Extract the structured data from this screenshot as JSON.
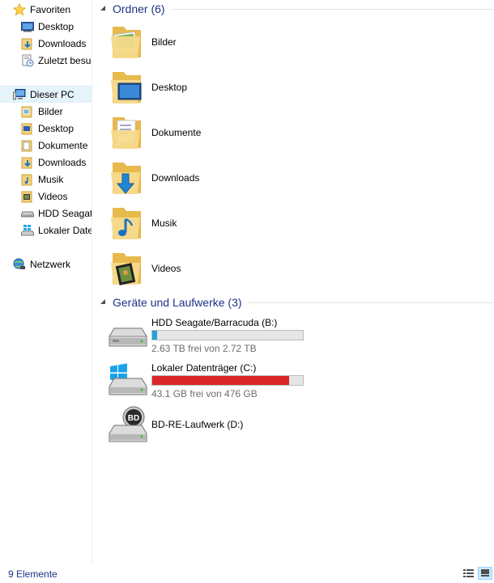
{
  "nav": {
    "favorites": {
      "label": "Favoriten",
      "icon": "star-icon",
      "items": [
        {
          "label": "Desktop",
          "icon": "desktop-icon"
        },
        {
          "label": "Downloads",
          "icon": "downloads-folder-icon"
        },
        {
          "label": "Zuletzt besucht",
          "icon": "recent-places-icon"
        }
      ]
    },
    "this_pc": {
      "label": "Dieser PC",
      "icon": "computer-icon",
      "items": [
        {
          "label": "Bilder",
          "icon": "pictures-folder-icon"
        },
        {
          "label": "Desktop",
          "icon": "desktop-folder-icon"
        },
        {
          "label": "Dokumente",
          "icon": "documents-folder-icon"
        },
        {
          "label": "Downloads",
          "icon": "downloads-folder-icon"
        },
        {
          "label": "Musik",
          "icon": "music-folder-icon"
        },
        {
          "label": "Videos",
          "icon": "videos-folder-icon"
        },
        {
          "label": "HDD Seagate/Barracuda (B:)",
          "icon": "hard-drive-icon"
        },
        {
          "label": "Lokaler Datenträger (C:)",
          "icon": "system-drive-icon"
        }
      ]
    },
    "network": {
      "label": "Netzwerk",
      "icon": "network-icon"
    }
  },
  "main": {
    "folders_group": {
      "title": "Ordner (6)",
      "items": [
        {
          "label": "Bilder",
          "icon": "pictures-folder-icon"
        },
        {
          "label": "Desktop",
          "icon": "desktop-folder-icon"
        },
        {
          "label": "Dokumente",
          "icon": "documents-folder-icon"
        },
        {
          "label": "Downloads",
          "icon": "downloads-folder-icon"
        },
        {
          "label": "Musik",
          "icon": "music-folder-icon"
        },
        {
          "label": "Videos",
          "icon": "videos-folder-icon"
        }
      ]
    },
    "drives_group": {
      "title": "Geräte und Laufwerke (3)",
      "items": [
        {
          "label": "HDD Seagate/Barracuda (B:)",
          "free_text": "2.63 TB frei von 2.72 TB",
          "used_fraction": 0.033,
          "bar_color": "#26a0da",
          "icon": "hard-drive-icon"
        },
        {
          "label": "Lokaler Datenträger (C:)",
          "free_text": "43.1 GB frei von 476 GB",
          "used_fraction": 0.909,
          "bar_color": "#da2626",
          "icon": "system-drive-icon"
        },
        {
          "label": "BD-RE-Laufwerk (D:)",
          "icon": "bd-drive-icon"
        }
      ]
    }
  },
  "status": {
    "item_count": "9 Elemente",
    "view_buttons": [
      {
        "icon": "details-view-icon"
      },
      {
        "icon": "large-icons-view-icon",
        "active": true
      }
    ]
  },
  "colors": {
    "accent": "#1e3287",
    "folder_yellow": "#f3d07a",
    "selection": "#e5f3fb"
  }
}
